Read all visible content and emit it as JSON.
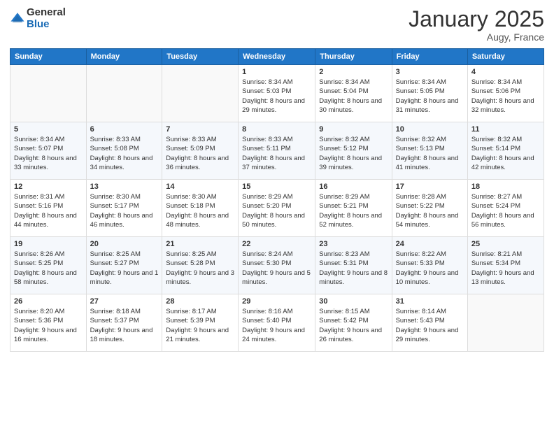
{
  "logo": {
    "general": "General",
    "blue": "Blue"
  },
  "header": {
    "month": "January 2025",
    "location": "Augy, France"
  },
  "days_of_week": [
    "Sunday",
    "Monday",
    "Tuesday",
    "Wednesday",
    "Thursday",
    "Friday",
    "Saturday"
  ],
  "weeks": [
    [
      {
        "day": "",
        "sunrise": "",
        "sunset": "",
        "daylight": ""
      },
      {
        "day": "",
        "sunrise": "",
        "sunset": "",
        "daylight": ""
      },
      {
        "day": "",
        "sunrise": "",
        "sunset": "",
        "daylight": ""
      },
      {
        "day": "1",
        "sunrise": "Sunrise: 8:34 AM",
        "sunset": "Sunset: 5:03 PM",
        "daylight": "Daylight: 8 hours and 29 minutes."
      },
      {
        "day": "2",
        "sunrise": "Sunrise: 8:34 AM",
        "sunset": "Sunset: 5:04 PM",
        "daylight": "Daylight: 8 hours and 30 minutes."
      },
      {
        "day": "3",
        "sunrise": "Sunrise: 8:34 AM",
        "sunset": "Sunset: 5:05 PM",
        "daylight": "Daylight: 8 hours and 31 minutes."
      },
      {
        "day": "4",
        "sunrise": "Sunrise: 8:34 AM",
        "sunset": "Sunset: 5:06 PM",
        "daylight": "Daylight: 8 hours and 32 minutes."
      }
    ],
    [
      {
        "day": "5",
        "sunrise": "Sunrise: 8:34 AM",
        "sunset": "Sunset: 5:07 PM",
        "daylight": "Daylight: 8 hours and 33 minutes."
      },
      {
        "day": "6",
        "sunrise": "Sunrise: 8:33 AM",
        "sunset": "Sunset: 5:08 PM",
        "daylight": "Daylight: 8 hours and 34 minutes."
      },
      {
        "day": "7",
        "sunrise": "Sunrise: 8:33 AM",
        "sunset": "Sunset: 5:09 PM",
        "daylight": "Daylight: 8 hours and 36 minutes."
      },
      {
        "day": "8",
        "sunrise": "Sunrise: 8:33 AM",
        "sunset": "Sunset: 5:11 PM",
        "daylight": "Daylight: 8 hours and 37 minutes."
      },
      {
        "day": "9",
        "sunrise": "Sunrise: 8:32 AM",
        "sunset": "Sunset: 5:12 PM",
        "daylight": "Daylight: 8 hours and 39 minutes."
      },
      {
        "day": "10",
        "sunrise": "Sunrise: 8:32 AM",
        "sunset": "Sunset: 5:13 PM",
        "daylight": "Daylight: 8 hours and 41 minutes."
      },
      {
        "day": "11",
        "sunrise": "Sunrise: 8:32 AM",
        "sunset": "Sunset: 5:14 PM",
        "daylight": "Daylight: 8 hours and 42 minutes."
      }
    ],
    [
      {
        "day": "12",
        "sunrise": "Sunrise: 8:31 AM",
        "sunset": "Sunset: 5:16 PM",
        "daylight": "Daylight: 8 hours and 44 minutes."
      },
      {
        "day": "13",
        "sunrise": "Sunrise: 8:30 AM",
        "sunset": "Sunset: 5:17 PM",
        "daylight": "Daylight: 8 hours and 46 minutes."
      },
      {
        "day": "14",
        "sunrise": "Sunrise: 8:30 AM",
        "sunset": "Sunset: 5:18 PM",
        "daylight": "Daylight: 8 hours and 48 minutes."
      },
      {
        "day": "15",
        "sunrise": "Sunrise: 8:29 AM",
        "sunset": "Sunset: 5:20 PM",
        "daylight": "Daylight: 8 hours and 50 minutes."
      },
      {
        "day": "16",
        "sunrise": "Sunrise: 8:29 AM",
        "sunset": "Sunset: 5:21 PM",
        "daylight": "Daylight: 8 hours and 52 minutes."
      },
      {
        "day": "17",
        "sunrise": "Sunrise: 8:28 AM",
        "sunset": "Sunset: 5:22 PM",
        "daylight": "Daylight: 8 hours and 54 minutes."
      },
      {
        "day": "18",
        "sunrise": "Sunrise: 8:27 AM",
        "sunset": "Sunset: 5:24 PM",
        "daylight": "Daylight: 8 hours and 56 minutes."
      }
    ],
    [
      {
        "day": "19",
        "sunrise": "Sunrise: 8:26 AM",
        "sunset": "Sunset: 5:25 PM",
        "daylight": "Daylight: 8 hours and 58 minutes."
      },
      {
        "day": "20",
        "sunrise": "Sunrise: 8:25 AM",
        "sunset": "Sunset: 5:27 PM",
        "daylight": "Daylight: 9 hours and 1 minute."
      },
      {
        "day": "21",
        "sunrise": "Sunrise: 8:25 AM",
        "sunset": "Sunset: 5:28 PM",
        "daylight": "Daylight: 9 hours and 3 minutes."
      },
      {
        "day": "22",
        "sunrise": "Sunrise: 8:24 AM",
        "sunset": "Sunset: 5:30 PM",
        "daylight": "Daylight: 9 hours and 5 minutes."
      },
      {
        "day": "23",
        "sunrise": "Sunrise: 8:23 AM",
        "sunset": "Sunset: 5:31 PM",
        "daylight": "Daylight: 9 hours and 8 minutes."
      },
      {
        "day": "24",
        "sunrise": "Sunrise: 8:22 AM",
        "sunset": "Sunset: 5:33 PM",
        "daylight": "Daylight: 9 hours and 10 minutes."
      },
      {
        "day": "25",
        "sunrise": "Sunrise: 8:21 AM",
        "sunset": "Sunset: 5:34 PM",
        "daylight": "Daylight: 9 hours and 13 minutes."
      }
    ],
    [
      {
        "day": "26",
        "sunrise": "Sunrise: 8:20 AM",
        "sunset": "Sunset: 5:36 PM",
        "daylight": "Daylight: 9 hours and 16 minutes."
      },
      {
        "day": "27",
        "sunrise": "Sunrise: 8:18 AM",
        "sunset": "Sunset: 5:37 PM",
        "daylight": "Daylight: 9 hours and 18 minutes."
      },
      {
        "day": "28",
        "sunrise": "Sunrise: 8:17 AM",
        "sunset": "Sunset: 5:39 PM",
        "daylight": "Daylight: 9 hours and 21 minutes."
      },
      {
        "day": "29",
        "sunrise": "Sunrise: 8:16 AM",
        "sunset": "Sunset: 5:40 PM",
        "daylight": "Daylight: 9 hours and 24 minutes."
      },
      {
        "day": "30",
        "sunrise": "Sunrise: 8:15 AM",
        "sunset": "Sunset: 5:42 PM",
        "daylight": "Daylight: 9 hours and 26 minutes."
      },
      {
        "day": "31",
        "sunrise": "Sunrise: 8:14 AM",
        "sunset": "Sunset: 5:43 PM",
        "daylight": "Daylight: 9 hours and 29 minutes."
      },
      {
        "day": "",
        "sunrise": "",
        "sunset": "",
        "daylight": ""
      }
    ]
  ]
}
